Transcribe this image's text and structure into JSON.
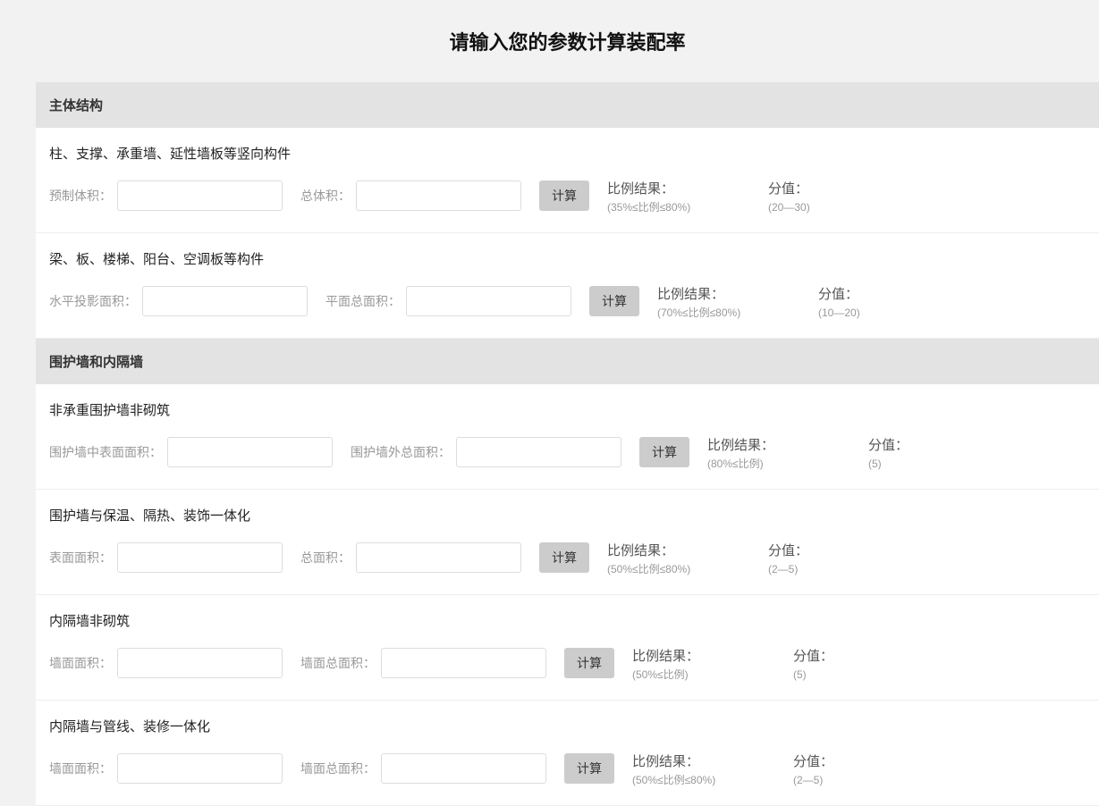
{
  "pageTitle": "请输入您的参数计算装配率",
  "sections": [
    {
      "header": "主体结构",
      "rows": [
        {
          "title": "柱、支撑、承重墙、延性墙板等竖向构件",
          "label1": "预制体积：",
          "label2": "总体积：",
          "calc": "计算",
          "ratioLabel": "比例结果：",
          "ratioHint": "(35%≤比例≤80%)",
          "scoreLabel": "分值：",
          "scoreHint": "(20—30)",
          "ratioColLeft": "660px",
          "scoreColLeft": "846px"
        },
        {
          "title": "梁、板、楼梯、阳台、空调板等构件",
          "label1": "水平投影面积：",
          "label2": "平面总面积：",
          "calc": "计算",
          "ratioLabel": "比例结果：",
          "ratioHint": "(70%≤比例≤80%)",
          "scoreLabel": "分值：",
          "scoreHint": "(10—20)",
          "ratioColLeft": "722px",
          "scoreColLeft": "908px"
        }
      ]
    },
    {
      "header": "围护墙和内隔墙",
      "rows": [
        {
          "title": "非承重围护墙非砌筑",
          "label1": "围护墙中表面面积：",
          "label2": "围护墙外总面积：",
          "calc": "计算",
          "ratioLabel": "比例结果：",
          "ratioHint": "(80%≤比例)",
          "scoreLabel": "分值：",
          "scoreHint": "(5)",
          "ratioColLeft": "778px",
          "scoreColLeft": "950px"
        },
        {
          "title": "围护墙与保温、隔热、装饰一体化",
          "label1": "表面面积：",
          "label2": "总面积：",
          "calc": "计算",
          "ratioLabel": "比例结果：",
          "ratioHint": "(50%≤比例≤80%)",
          "scoreLabel": "分值：",
          "scoreHint": "(2—5)",
          "ratioColLeft": "660px",
          "scoreColLeft": "846px"
        },
        {
          "title": "内隔墙非砌筑",
          "label1": "墙面面积：",
          "label2": "墙面总面积：",
          "calc": "计算",
          "ratioLabel": "比例结果：",
          "ratioHint": "(50%≤比例)",
          "scoreLabel": "分值：",
          "scoreHint": "(5)",
          "ratioColLeft": "688px",
          "scoreColLeft": "860px"
        },
        {
          "title": "内隔墙与管线、装修一体化",
          "label1": "墙面面积：",
          "label2": "墙面总面积：",
          "calc": "计算",
          "ratioLabel": "比例结果：",
          "ratioHint": "(50%≤比例≤80%)",
          "scoreLabel": "分值：",
          "scoreHint": "(2—5)",
          "ratioColLeft": "688px",
          "scoreColLeft": "874px"
        }
      ]
    }
  ]
}
